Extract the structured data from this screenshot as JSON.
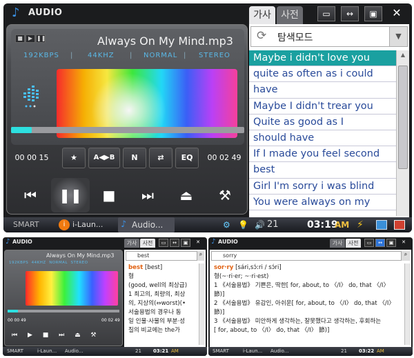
{
  "app": {
    "title": "AUDIO"
  },
  "player": {
    "mini_controls": [
      "■",
      "▶",
      "❚❚"
    ],
    "song_title": "Always On My Mind.mp3",
    "info": [
      "192KBPS",
      "|",
      "44KHZ",
      "|",
      "NORMAL",
      "|",
      "STEREO"
    ],
    "progress": 0.09,
    "time_elapsed": "00 00 15",
    "time_total": "00 02 49",
    "buttons": {
      "favorite": "★",
      "ab_repeat": "A◀▶B",
      "normal": "N",
      "repeat": "⇄",
      "eq": "EQ"
    },
    "transport": {
      "prev": "⏮",
      "pause": "❚❚",
      "stop": "■",
      "next": "⏭",
      "eject": "⏏",
      "tool": "⚒"
    }
  },
  "tabs": {
    "lyrics": "가사",
    "dictionary": "사전"
  },
  "window_buttons": {
    "minimize": "▭",
    "resize": "↔",
    "mini": "▣",
    "close": "✕"
  },
  "search": {
    "mode": "탐색모드"
  },
  "lyrics": [
    "Maybe i didn't love you",
    "quite as often as i could",
    "have",
    "Maybe I didn't trear you",
    "Quite as good as I",
    "should have",
    "If I made you feel second",
    "best",
    "Girl I'm sorry i was blind",
    "You were always on my"
  ],
  "taskbar": {
    "smart": "SMART",
    "app1": "i-Laun...",
    "app2": "Audio...",
    "volume": "21",
    "clock": "03:19",
    "ampm": "AM"
  },
  "small_left": {
    "song_title": "Always On My Mind.mp3",
    "info": "192KBPS  44KHZ  NORMAL  STEREO",
    "time_elapsed": "00 00 49",
    "time_total": "00 02 49",
    "search_value": "best",
    "headword": "best",
    "pron": "[best]",
    "lines": [
      "형",
      "(good, well의 최상급)",
      "1 최고의, 최량의, 최상",
      "의, 지상의(⇔worst)(•",
      "서술용법의 경우나 동",
      "일 인물·사물의 부분·성",
      "질의 비교에는 the가"
    ],
    "taskbar": {
      "smart": "SMART",
      "app1": "i-Laun...",
      "app2": "Audio...",
      "volume": "21",
      "clock": "03:21",
      "ampm": "AM"
    }
  },
  "small_right": {
    "search_value": "sorry",
    "headword": "sor·ry",
    "pron": "[sári,sɔ́:ri / sɔ́ri]",
    "lines": [
      "형(~·ri·er; ~·ri·est)",
      "1 《서술용법》 기쁜은, 딱한[ for, about, to 〈/I〉 do, that 〈/I〉",
      "節)]",
      "2 《서술용법》 유감인, 아쉬운[ for, about, to 〈/I〉 do, that 〈/I〉",
      "節)]",
      "3 《서술용법》 미안하게 생각하는, 잘못했다고 생각하는, 후회하는",
      "[ for, about, to 〈/I〉 do, that 〈/I〉 節)]"
    ],
    "taskbar": {
      "smart": "SMART",
      "app1": "i-Laun...",
      "app2": "Audio...",
      "volume": "21",
      "clock": "03:22",
      "ampm": "AM"
    }
  },
  "colors": {
    "accent": "#1aa0a0",
    "lyric_text": "#2a4b9a",
    "progress": "#2de0e0",
    "clock_am": "#f0c040"
  }
}
